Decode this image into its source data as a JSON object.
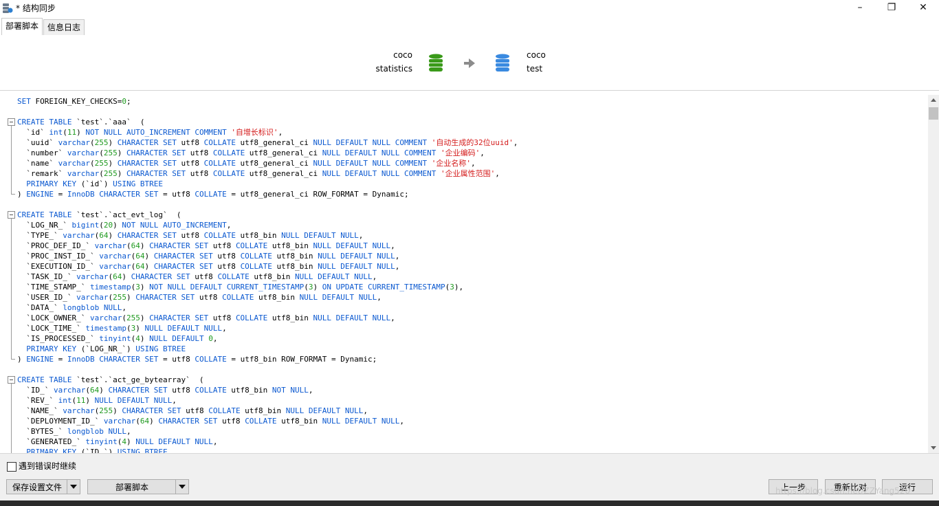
{
  "window": {
    "title": "* 结构同步"
  },
  "tabs": [
    {
      "label": "部署脚本"
    },
    {
      "label": "信息日志"
    }
  ],
  "header": {
    "source": {
      "connection": "coco",
      "database": "statistics"
    },
    "target": {
      "connection": "coco",
      "database": "test"
    }
  },
  "footer": {
    "continue_on_error_label": "遇到错误时继续",
    "continue_on_error_checked": false,
    "save_settings_label": "保存设置文件",
    "deploy_script_label": "部署脚本",
    "prev_label": "上一步",
    "recompare_label": "重新比对",
    "run_label": "运行"
  },
  "watermark": "https://blog.csdn.net/ZZYang520",
  "colors": {
    "keyword": "#0a58d0",
    "number": "#1f9a1f",
    "string": "#d41b1b",
    "source_db": "#3a9a1a",
    "target_db": "#3a8ae0"
  },
  "script_lines": [
    "SET FOREIGN_KEY_CHECKS=0;",
    "",
    "CREATE TABLE `test`.`aaa`  (",
    "  `id` int(11) NOT NULL AUTO_INCREMENT COMMENT '自增长标识',",
    "  `uuid` varchar(255) CHARACTER SET utf8 COLLATE utf8_general_ci NULL DEFAULT NULL COMMENT '自动生成的32位uuid',",
    "  `number` varchar(255) CHARACTER SET utf8 COLLATE utf8_general_ci NULL DEFAULT NULL COMMENT '企业编码',",
    "  `name` varchar(255) CHARACTER SET utf8 COLLATE utf8_general_ci NULL DEFAULT NULL COMMENT '企业名称',",
    "  `remark` varchar(255) CHARACTER SET utf8 COLLATE utf8_general_ci NULL DEFAULT NULL COMMENT '企业属性范围',",
    "  PRIMARY KEY (`id`) USING BTREE",
    ") ENGINE = InnoDB CHARACTER SET = utf8 COLLATE = utf8_general_ci ROW_FORMAT = Dynamic;",
    "",
    "CREATE TABLE `test`.`act_evt_log`  (",
    "  `LOG_NR_` bigint(20) NOT NULL AUTO_INCREMENT,",
    "  `TYPE_` varchar(64) CHARACTER SET utf8 COLLATE utf8_bin NULL DEFAULT NULL,",
    "  `PROC_DEF_ID_` varchar(64) CHARACTER SET utf8 COLLATE utf8_bin NULL DEFAULT NULL,",
    "  `PROC_INST_ID_` varchar(64) CHARACTER SET utf8 COLLATE utf8_bin NULL DEFAULT NULL,",
    "  `EXECUTION_ID_` varchar(64) CHARACTER SET utf8 COLLATE utf8_bin NULL DEFAULT NULL,",
    "  `TASK_ID_` varchar(64) CHARACTER SET utf8 COLLATE utf8_bin NULL DEFAULT NULL,",
    "  `TIME_STAMP_` timestamp(3) NOT NULL DEFAULT CURRENT_TIMESTAMP(3) ON UPDATE CURRENT_TIMESTAMP(3),",
    "  `USER_ID_` varchar(255) CHARACTER SET utf8 COLLATE utf8_bin NULL DEFAULT NULL,",
    "  `DATA_` longblob NULL,",
    "  `LOCK_OWNER_` varchar(255) CHARACTER SET utf8 COLLATE utf8_bin NULL DEFAULT NULL,",
    "  `LOCK_TIME_` timestamp(3) NULL DEFAULT NULL,",
    "  `IS_PROCESSED_` tinyint(4) NULL DEFAULT 0,",
    "  PRIMARY KEY (`LOG_NR_`) USING BTREE",
    ") ENGINE = InnoDB CHARACTER SET = utf8 COLLATE = utf8_bin ROW_FORMAT = Dynamic;",
    "",
    "CREATE TABLE `test`.`act_ge_bytearray`  (",
    "  `ID_` varchar(64) CHARACTER SET utf8 COLLATE utf8_bin NOT NULL,",
    "  `REV_` int(11) NULL DEFAULT NULL,",
    "  `NAME_` varchar(255) CHARACTER SET utf8 COLLATE utf8_bin NULL DEFAULT NULL,",
    "  `DEPLOYMENT_ID_` varchar(64) CHARACTER SET utf8 COLLATE utf8_bin NULL DEFAULT NULL,",
    "  `BYTES_` longblob NULL,",
    "  `GENERATED_` tinyint(4) NULL DEFAULT NULL,",
    "  PRIMARY KEY (`ID_`) USING BTREE"
  ]
}
